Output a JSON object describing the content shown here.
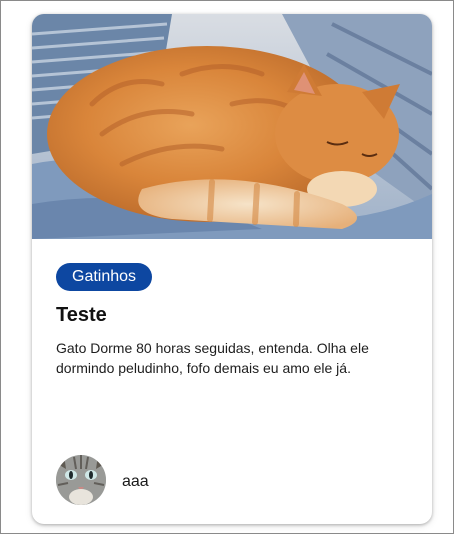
{
  "card": {
    "image_alt": "orange cat sleeping curled up on a blanket",
    "tag": "Gatinhos",
    "title": "Teste",
    "description": "Gato Dorme 80 horas seguidas, entenda. Olha ele dormindo peludinho, fofo demais eu amo ele já.",
    "author": {
      "name": "aaa",
      "avatar": "tabby-cat-avatar"
    }
  },
  "colors": {
    "tag_background": "#0d47a1",
    "tag_text": "#ffffff",
    "card_background": "#ffffff",
    "frame_border": "#8a8a8a"
  }
}
